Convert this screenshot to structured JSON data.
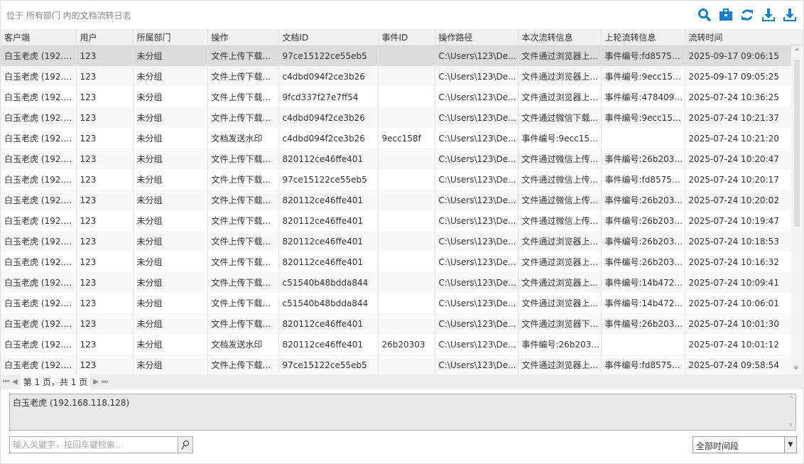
{
  "header": {
    "title": "位于 所有部门 内的文档流转日志"
  },
  "toolbar": [
    "search-icon",
    "briefcase-icon",
    "refresh-icon",
    "download-icon",
    "export-icon"
  ],
  "accent": "#1a7fc4",
  "columns": [
    "客户端",
    "用户",
    "所属部门",
    "操作",
    "文档ID",
    "事件ID",
    "操作路径",
    "本次流转信息",
    "上轮流转信息",
    "流转时间"
  ],
  "rows": [
    [
      "白玉老虎 (192.1...",
      "123",
      "未分组",
      "文件上传下载...",
      "97ce15122ce55eb5",
      "",
      "C:\\Users\\123\\De...",
      "文件通过浏览器上...",
      "事件编号:fd85752...",
      "2025-09-17 09:06:15"
    ],
    [
      "白玉老虎 (192.1...",
      "123",
      "未分组",
      "文件上传下载...",
      "c4dbd094f2ce3b26",
      "",
      "C:\\Users\\123\\De...",
      "文件通过浏览器上...",
      "事件编号:9ecc158...",
      "2025-09-17 09:05:25"
    ],
    [
      "白玉老虎 (192.1...",
      "123",
      "未分组",
      "文件上传下载...",
      "9fcd337f27e7ff54",
      "",
      "C:\\Users\\123\\De...",
      "文件通过浏览器上...",
      "事件编号:478409d...",
      "2025-07-24 10:36:25"
    ],
    [
      "白玉老虎 (192.1...",
      "123",
      "未分组",
      "文件上传下载...",
      "c4dbd094f2ce3b26",
      "",
      "C:\\Users\\123\\De...",
      "文件通过微信下载...",
      "事件编号:9ecc158...",
      "2025-07-24 10:21:37"
    ],
    [
      "白玉老虎 (192.1...",
      "123",
      "未分组",
      "文档发送水印",
      "c4dbd094f2ce3b26",
      "9ecc158f",
      "C:\\Users\\123\\De...",
      "事件编号:9ecc158...",
      "",
      "2025-07-24 10:21:20"
    ],
    [
      "白玉老虎 (192.1...",
      "123",
      "未分组",
      "文件上传下载...",
      "820112ce46ffe401",
      "",
      "C:\\Users\\123\\De...",
      "文件通过微信上传...",
      "事件编号:26b2030...",
      "2025-07-24 10:20:47"
    ],
    [
      "白玉老虎 (192.1...",
      "123",
      "未分组",
      "文件上传下载...",
      "97ce15122ce55eb5",
      "",
      "C:\\Users\\123\\De...",
      "文件通过微信上传...",
      "事件编号:fd85752...",
      "2025-07-24 10:20:17"
    ],
    [
      "白玉老虎 (192.1...",
      "123",
      "未分组",
      "文件上传下载...",
      "820112ce46ffe401",
      "",
      "C:\\Users\\123\\De...",
      "文件通过微信上传...",
      "事件编号:26b2030...",
      "2025-07-24 10:20:02"
    ],
    [
      "白玉老虎 (192.1...",
      "123",
      "未分组",
      "文件上传下载...",
      "820112ce46ffe401",
      "",
      "C:\\Users\\123\\De...",
      "文件通过微信上传...",
      "事件编号:26b2030...",
      "2025-07-24 10:19:47"
    ],
    [
      "白玉老虎 (192.1...",
      "123",
      "未分组",
      "文件上传下载...",
      "820112ce46ffe401",
      "",
      "C:\\Users\\123\\De...",
      "文件通过浏览器上...",
      "事件编号:26b2030...",
      "2025-07-24 10:18:53"
    ],
    [
      "白玉老虎 (192.1...",
      "123",
      "未分组",
      "文件上传下载...",
      "820112ce46ffe401",
      "",
      "C:\\Users\\123\\De...",
      "文件通过浏览器上...",
      "事件编号:26b2030...",
      "2025-07-24 10:16:32"
    ],
    [
      "白玉老虎 (192.1...",
      "123",
      "未分组",
      "文件上传下载...",
      "c51540b48bdda844",
      "",
      "C:\\Users\\123\\De...",
      "文件通过浏览器上...",
      "事件编号:14b4728...",
      "2025-07-24 10:09:41"
    ],
    [
      "白玉老虎 (192.1...",
      "123",
      "未分组",
      "文件上传下载...",
      "c51540b48bdda844",
      "",
      "C:\\Users\\123\\De...",
      "文件通过浏览器上...",
      "事件编号:14b4728...",
      "2025-07-24 10:06:01"
    ],
    [
      "白玉老虎 (192.1...",
      "123",
      "未分组",
      "文件上传下载...",
      "820112ce46ffe401",
      "",
      "C:\\Users\\123\\De...",
      "文件通过浏览器下...",
      "事件编号:26b2030...",
      "2025-07-24 10:01:30"
    ],
    [
      "白玉老虎 (192.1...",
      "123",
      "未分组",
      "文档发送水印",
      "820112ce46ffe401",
      "26b20303",
      "C:\\Users\\123\\De...",
      "事件编号:26b203...",
      "",
      "2025-07-24 10:01:12"
    ],
    [
      "白玉老虎 (192.1...",
      "123",
      "未分组",
      "文件上传下载...",
      "97ce15122ce55eb5",
      "",
      "C:\\Users\\123\\De...",
      "文件通过浏览器上...",
      "事件编号:fd85752...",
      "2025-07-24 09:58:54"
    ]
  ],
  "pager": {
    "text": "第 1 页，共 1 页"
  },
  "detail": {
    "text": "白玉老虎 (192.168.118.128)"
  },
  "search": {
    "placeholder": "输入关键字，按回车键检索..."
  },
  "time_filter": {
    "value": "全部时间段"
  }
}
